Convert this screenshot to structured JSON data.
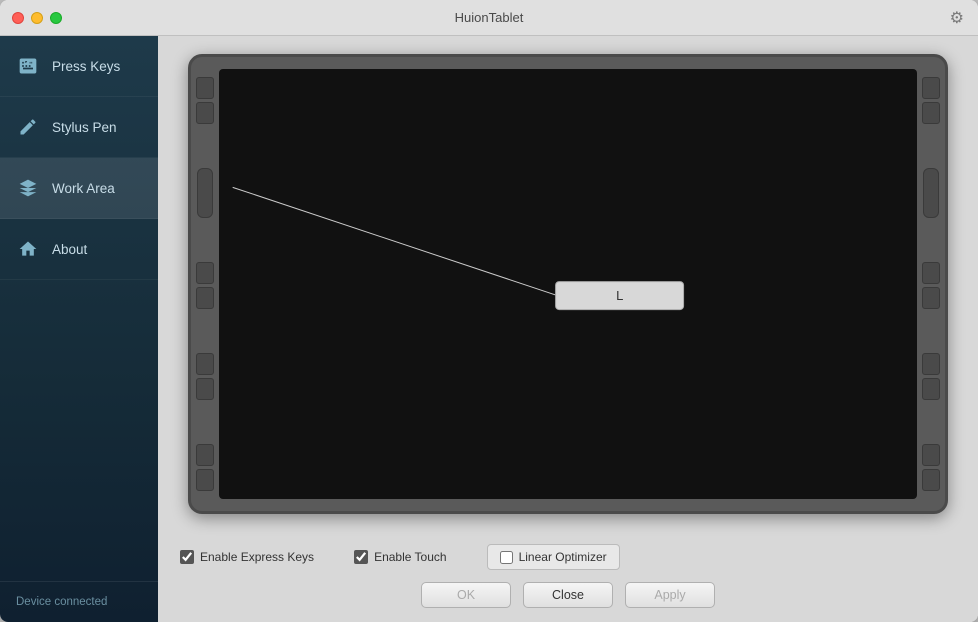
{
  "window": {
    "title": "HuionTablet"
  },
  "sidebar": {
    "items": [
      {
        "id": "press-keys",
        "label": "Press Keys",
        "active": false
      },
      {
        "id": "stylus-pen",
        "label": "Stylus Pen",
        "active": false
      },
      {
        "id": "work-area",
        "label": "Work Area",
        "active": true
      },
      {
        "id": "about",
        "label": "About",
        "active": false
      }
    ],
    "status_label": "Device connected"
  },
  "tablet": {
    "screen_label": "L"
  },
  "bottom": {
    "enable_express_keys_label": "Enable Express Keys",
    "enable_express_keys_checked": true,
    "enable_touch_label": "Enable Touch",
    "enable_touch_checked": true,
    "linear_optimizer_label": "Linear Optimizer"
  },
  "buttons": {
    "ok_label": "OK",
    "close_label": "Close",
    "apply_label": "Apply"
  }
}
